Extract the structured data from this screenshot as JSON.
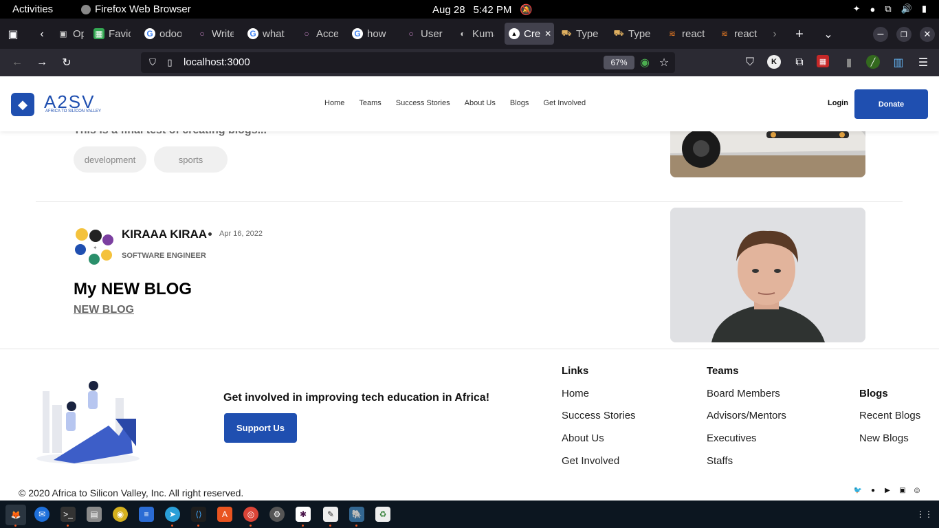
{
  "system_bar": {
    "activities": "Activities",
    "app_name": "Firefox Web Browser",
    "date": "Aug 28",
    "time": "5:42 PM"
  },
  "browser": {
    "tabs": [
      {
        "label": "Oper",
        "icon": "firefox-view-icon"
      },
      {
        "label": "Favic",
        "icon": "green-square-icon"
      },
      {
        "label": "odoo",
        "icon": "google-icon"
      },
      {
        "label": "Write",
        "icon": "circle-icon"
      },
      {
        "label": "what",
        "icon": "google-icon"
      },
      {
        "label": "Acce",
        "icon": "circle-icon"
      },
      {
        "label": "how",
        "icon": "google-icon"
      },
      {
        "label": "User",
        "icon": "circle-icon"
      },
      {
        "label": "Kuma",
        "icon": "github-icon"
      },
      {
        "label": "Cre",
        "icon": "vercel-icon",
        "active": true
      },
      {
        "label": "Type",
        "icon": "typescript-icon"
      },
      {
        "label": "Type",
        "icon": "typescript-icon"
      },
      {
        "label": "react",
        "icon": "stackoverflow-icon"
      },
      {
        "label": "react",
        "icon": "stackoverflow-icon"
      }
    ],
    "url": "localhost:3000",
    "zoom": "67%"
  },
  "site": {
    "logo_text": "A2SV",
    "logo_sub": "AFRICA TO SILICON VALLEY",
    "menu": [
      "Home",
      "Teams",
      "Success Stories",
      "About Us",
      "Blogs",
      "Get Involved"
    ],
    "login": "Login",
    "donate": "Donate"
  },
  "prev_post": {
    "excerpt": "This is a final test of creating blogs...",
    "tags": [
      "development",
      "sports"
    ]
  },
  "post": {
    "author": "KIRAAA KIRAA",
    "date": "Apr 16, 2022",
    "role": "SOFTWARE ENGINEER",
    "title": "My NEW BLOG",
    "link": "NEW BLOG"
  },
  "footer": {
    "cta": "Get involved in improving tech education in Africa!",
    "support": "Support Us",
    "links_head": "Links",
    "links": [
      "Home",
      "Success Stories",
      "About Us",
      "Get Involved"
    ],
    "teams_head": "Teams",
    "teams": [
      "Board Members",
      "Advisors/Mentors",
      "Executives",
      "Staffs"
    ],
    "blogs_head": "Blogs",
    "blogs": [
      "Recent Blogs",
      "New Blogs"
    ],
    "copyright": "© 2020 Africa to Silicon Valley, Inc. All right reserved."
  },
  "colors": {
    "brand": "#1f4fb0",
    "tab_bar": "#1c1b22",
    "toolbar": "#2b2a33"
  }
}
